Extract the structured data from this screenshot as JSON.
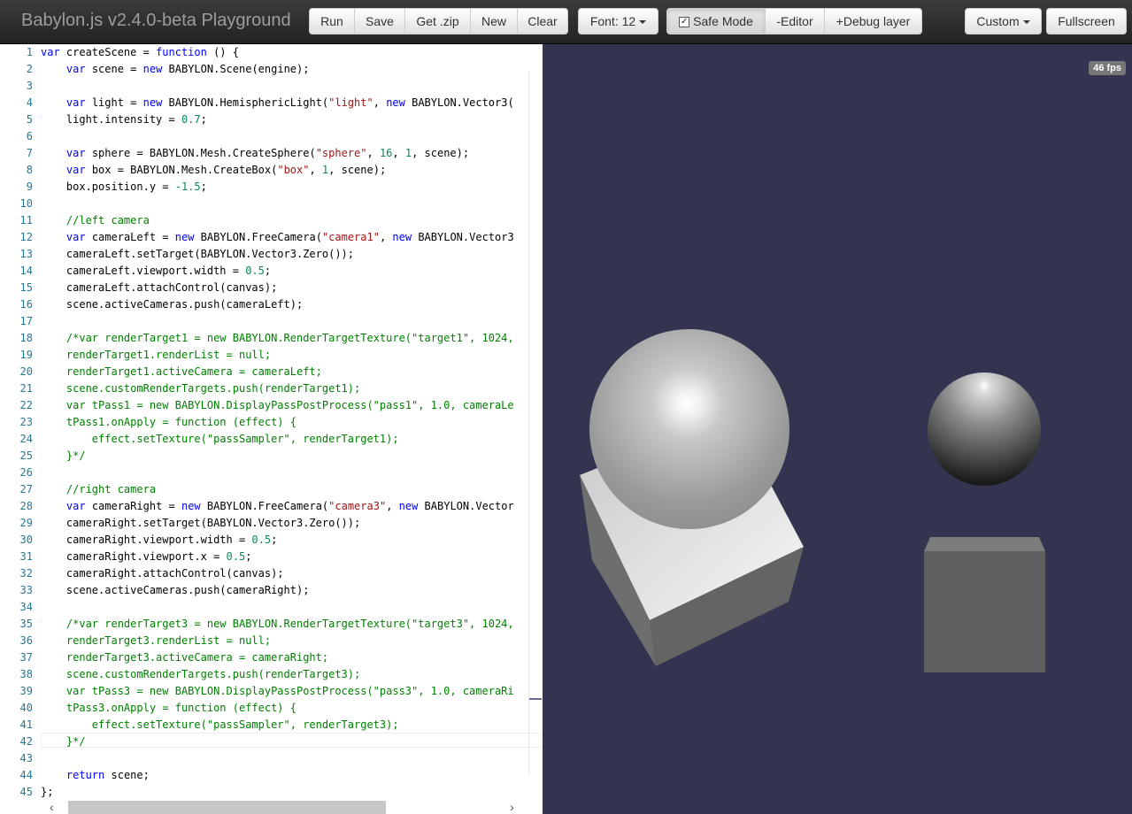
{
  "navbar": {
    "title": "Babylon.js v2.4.0-beta Playground",
    "buttons": {
      "run": "Run",
      "save": "Save",
      "get_zip": "Get .zip",
      "new": "New",
      "clear": "Clear",
      "font": "Font: 12",
      "safe_mode": "Safe Mode",
      "safe_mode_checked": true,
      "editor": "-Editor",
      "debug_layer": "+Debug layer",
      "custom": "Custom",
      "fullscreen": "Fullscreen"
    }
  },
  "editor": {
    "lines": [
      "var createScene = function () {",
      "    var scene = new BABYLON.Scene(engine);",
      "",
      "    var light = new BABYLON.HemisphericLight(\"light\", new BABYLON.Vector3(",
      "    light.intensity = 0.7;",
      "",
      "    var sphere = BABYLON.Mesh.CreateSphere(\"sphere\", 16, 1, scene);",
      "    var box = BABYLON.Mesh.CreateBox(\"box\", 1, scene);",
      "    box.position.y = -1.5;",
      "",
      "    //left camera",
      "    var cameraLeft = new BABYLON.FreeCamera(\"camera1\", new BABYLON.Vector3",
      "    cameraLeft.setTarget(BABYLON.Vector3.Zero());",
      "    cameraLeft.viewport.width = 0.5;",
      "    cameraLeft.attachControl(canvas);",
      "    scene.activeCameras.push(cameraLeft);",
      "",
      "    /*var renderTarget1 = new BABYLON.RenderTargetTexture(\"target1\", 1024,",
      "    renderTarget1.renderList = null;",
      "    renderTarget1.activeCamera = cameraLeft;",
      "    scene.customRenderTargets.push(renderTarget1);",
      "    var tPass1 = new BABYLON.DisplayPassPostProcess(\"pass1\", 1.0, cameraLe",
      "    tPass1.onApply = function (effect) {",
      "        effect.setTexture(\"passSampler\", renderTarget1);",
      "    }*/",
      "",
      "    //right camera",
      "    var cameraRight = new BABYLON.FreeCamera(\"camera3\", new BABYLON.Vector",
      "    cameraRight.setTarget(BABYLON.Vector3.Zero());",
      "    cameraRight.viewport.width = 0.5;",
      "    cameraRight.viewport.x = 0.5;",
      "    cameraRight.attachControl(canvas);",
      "    scene.activeCameras.push(cameraRight);",
      "",
      "    /*var renderTarget3 = new BABYLON.RenderTargetTexture(\"target3\", 1024,",
      "    renderTarget3.renderList = null;",
      "    renderTarget3.activeCamera = cameraRight;",
      "    scene.customRenderTargets.push(renderTarget3);",
      "    var tPass3 = new BABYLON.DisplayPassPostProcess(\"pass3\", 1.0, cameraRi",
      "    tPass3.onApply = function (effect) {",
      "        effect.setTexture(\"passSampler\", renderTarget3);",
      "    }*/",
      "",
      "    return scene;",
      "};"
    ],
    "scroll_left_arrow": "‹",
    "scroll_right_arrow": "›"
  },
  "canvas": {
    "fps": "46 fps",
    "background_color": "#333550"
  }
}
